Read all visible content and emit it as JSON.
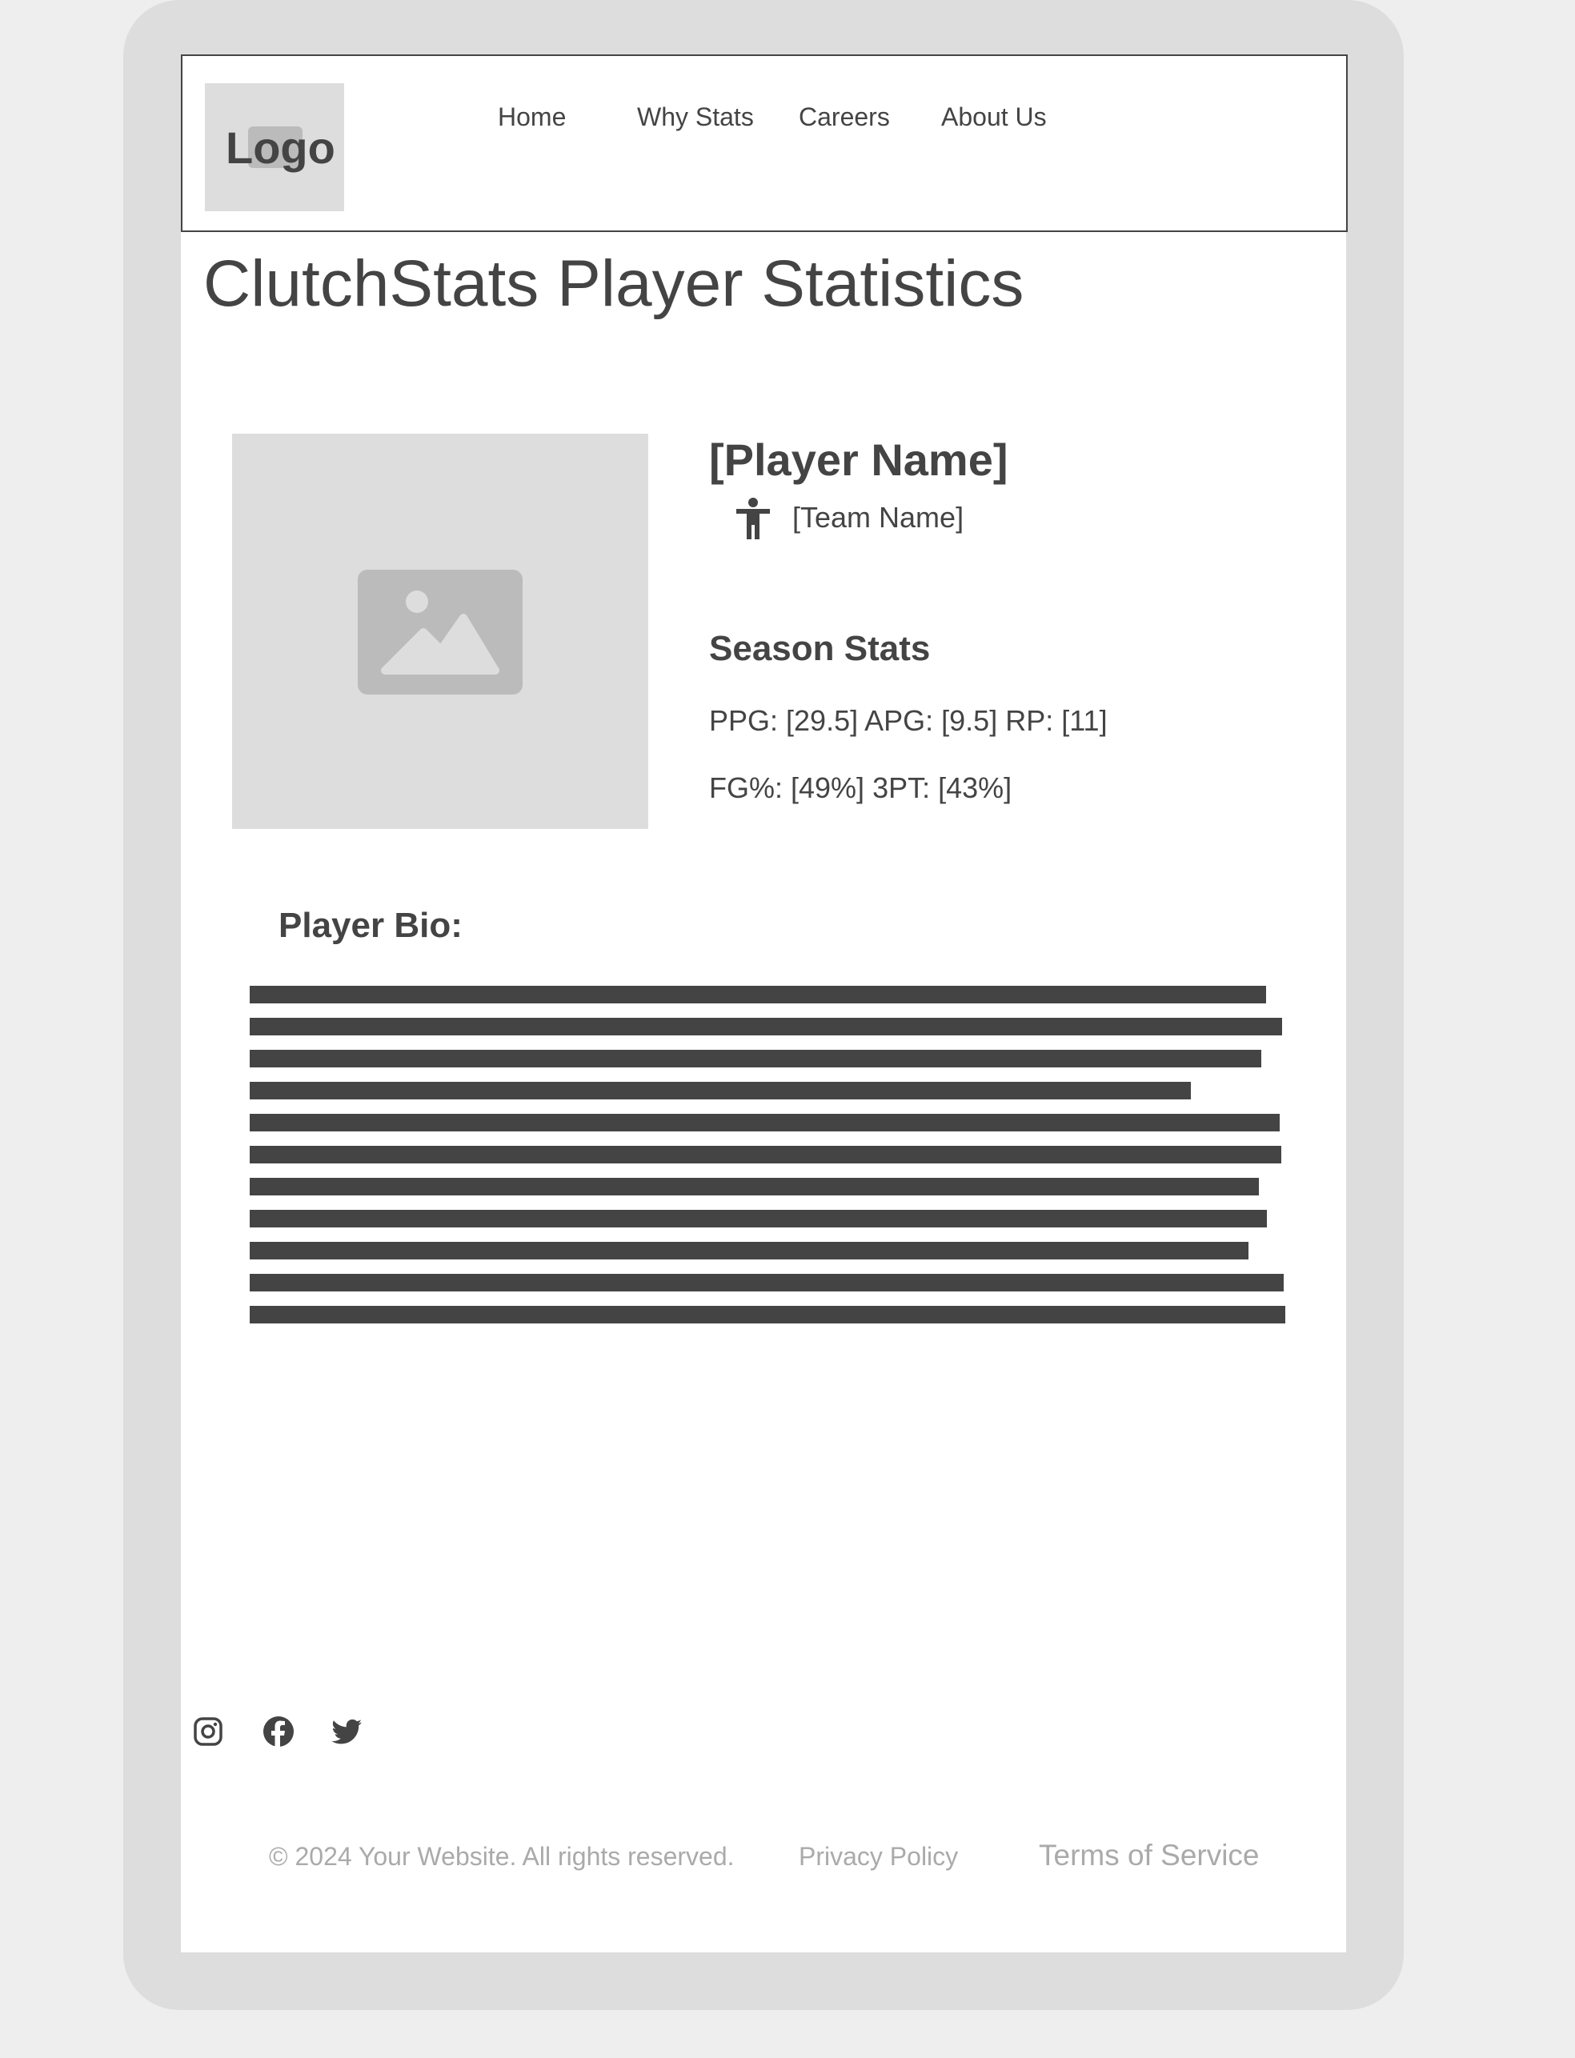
{
  "header": {
    "logo_text": "Logo",
    "nav": [
      {
        "label": "Home"
      },
      {
        "label": "Why Stats"
      },
      {
        "label": "Careers"
      },
      {
        "label": "About Us"
      }
    ]
  },
  "page": {
    "title": "ClutchStats Player Statistics"
  },
  "player": {
    "photo_icon": "image-placeholder-icon",
    "name": "[Player Name]",
    "team_icon": "person-icon",
    "team": "[Team Name]",
    "season_heading": "Season Stats",
    "stats_line_1": "PPG: [29.5] APG: [9.5] RP: [11]",
    "stats_line_2": "FG%: [49%] 3PT: [43%]"
  },
  "bio": {
    "heading": "Player Bio:",
    "line_count": 11
  },
  "social": {
    "icons": [
      "instagram-icon",
      "facebook-icon",
      "twitter-icon"
    ]
  },
  "footer": {
    "copyright": "© 2024 Your Website. All rights reserved.",
    "privacy": "Privacy Policy",
    "terms": "Terms of Service"
  },
  "colors": {
    "text": "#444444",
    "muted": "#aaaaaa",
    "frame": "#dddddd",
    "background": "#eeeeee"
  }
}
